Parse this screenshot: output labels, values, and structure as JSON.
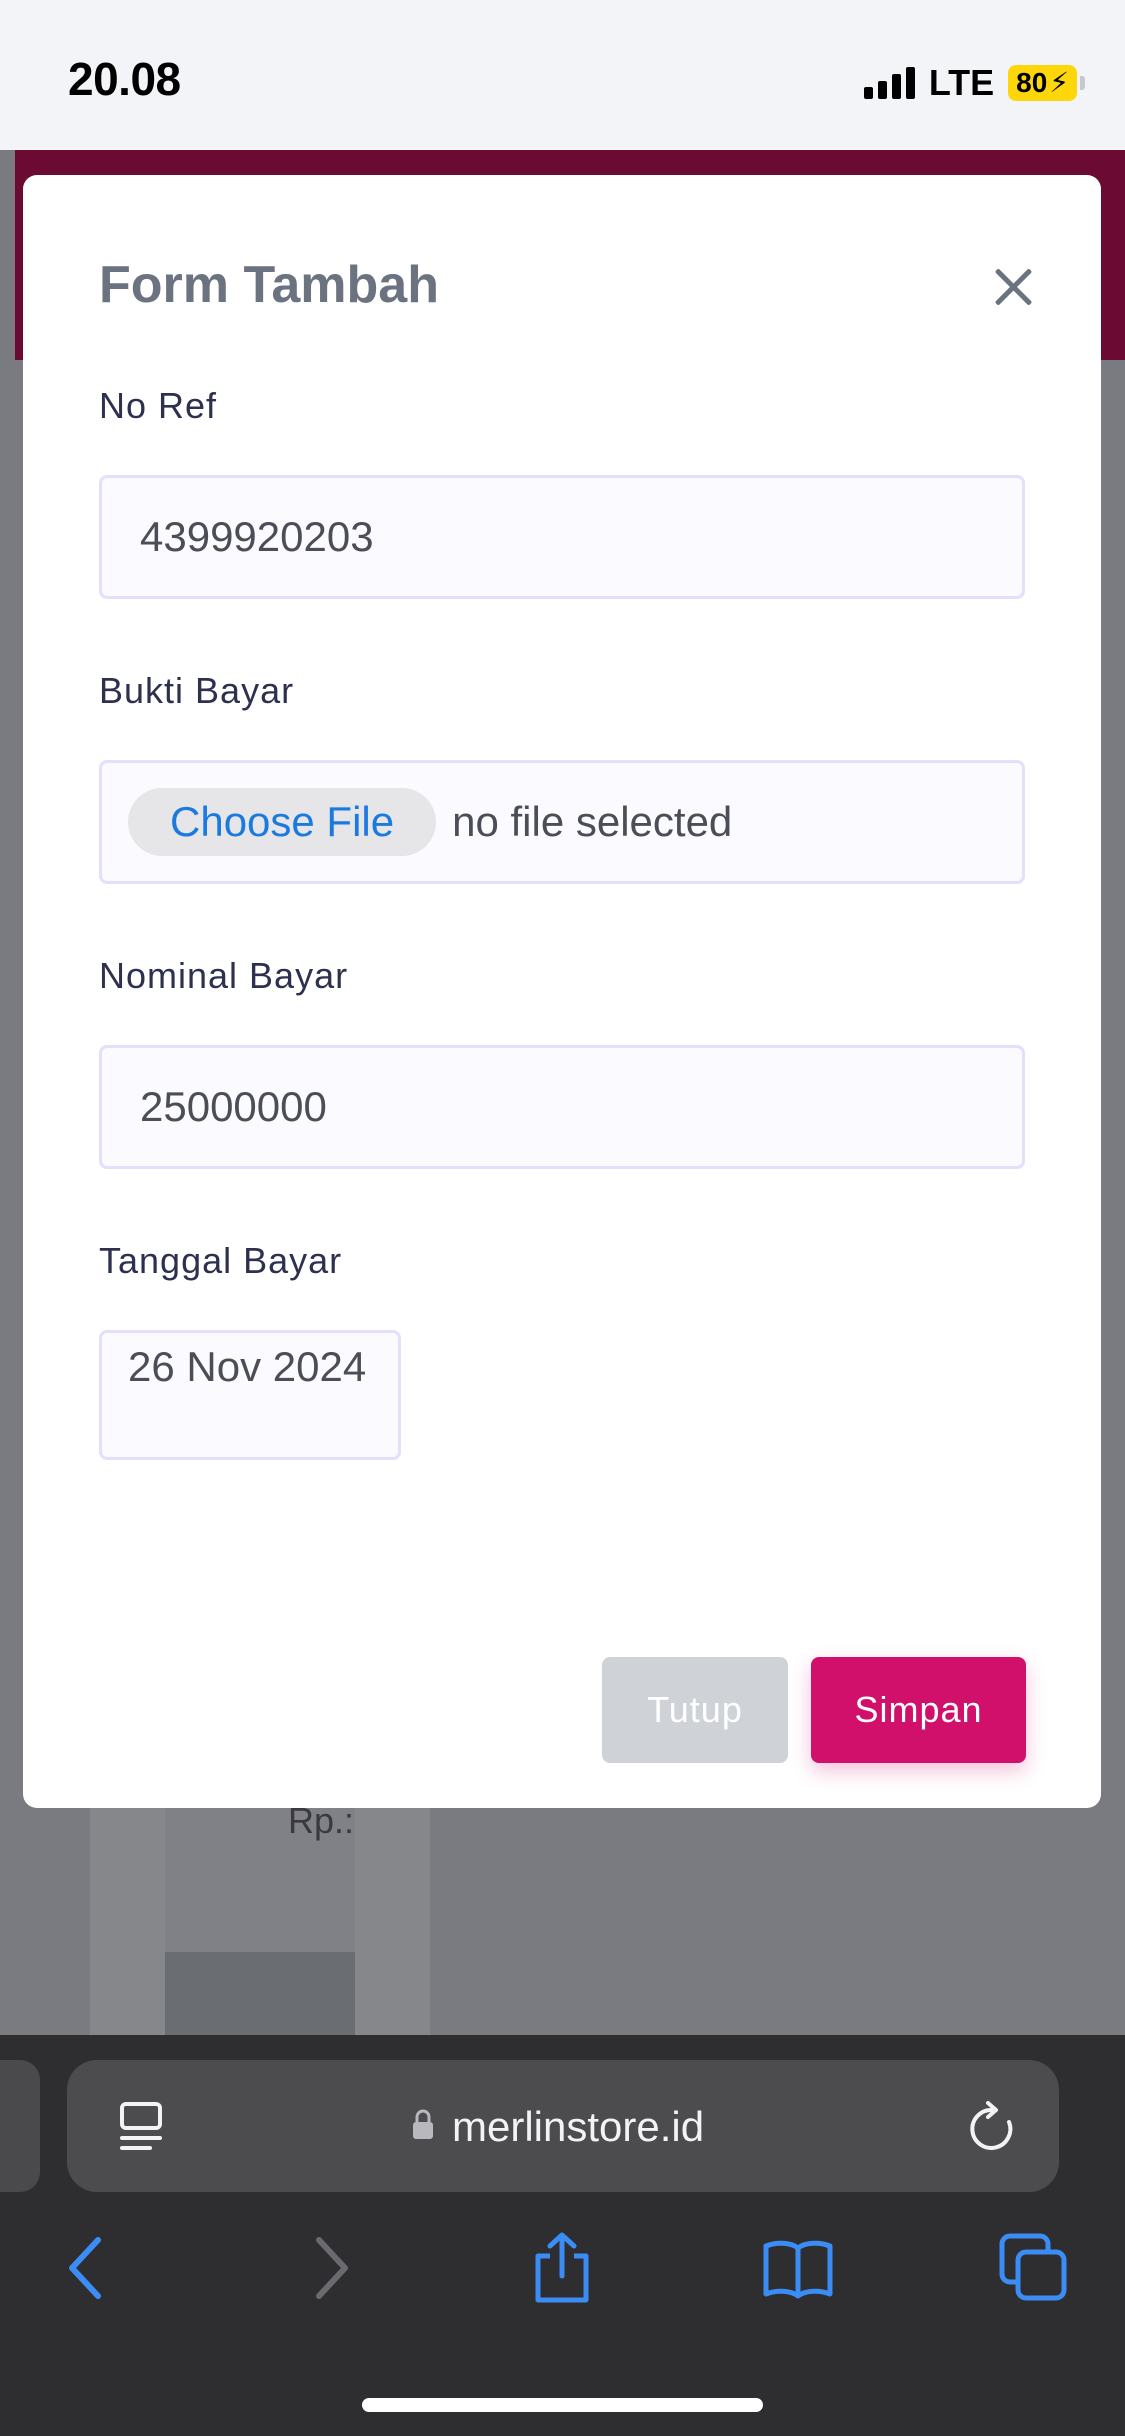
{
  "status_bar": {
    "time": "20.08",
    "network": "LTE",
    "battery": "80"
  },
  "background": {
    "price_fragment": "Rp.:"
  },
  "modal": {
    "title": "Form Tambah",
    "fields": {
      "no_ref": {
        "label": "No Ref",
        "value": "4399920203"
      },
      "bukti_bayar": {
        "label": "Bukti Bayar",
        "button": "Choose File",
        "status": "no file selected"
      },
      "nominal_bayar": {
        "label": "Nominal Bayar",
        "value": "25000000"
      },
      "tanggal_bayar": {
        "label": "Tanggal Bayar",
        "value": "26 Nov 2024"
      }
    },
    "buttons": {
      "close": "Tutup",
      "save": "Simpan"
    }
  },
  "browser": {
    "url": "merlinstore.id"
  },
  "icons": [
    "signal-icon",
    "battery-icon",
    "close-icon",
    "lock-icon",
    "reader-icon",
    "reload-icon",
    "back-icon",
    "forward-icon",
    "share-icon",
    "bookmarks-icon",
    "tabs-icon"
  ],
  "colors": {
    "accent": "#d1106b",
    "header_bg": "#6b0a33",
    "link_blue": "#1a7ae0"
  }
}
